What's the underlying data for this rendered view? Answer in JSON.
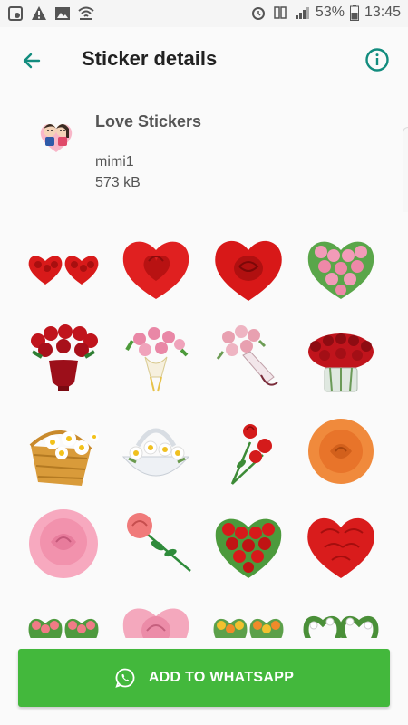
{
  "status_bar": {
    "battery_percent": "53%",
    "time": "13:45",
    "icons": [
      "gallery-icon",
      "alert-icon",
      "image-icon",
      "wifi-icon",
      "alarm-icon",
      "signal-icon",
      "battery-icon"
    ]
  },
  "app_bar": {
    "title": "Sticker details",
    "back_icon": "arrow-left-icon",
    "info_icon": "info-icon",
    "accent_color": "#128c7e"
  },
  "pack": {
    "name": "Love Stickers",
    "author": "mimi1",
    "size": "573 kB"
  },
  "stickers": [
    {
      "name": "double-heart-roses"
    },
    {
      "name": "red-rose-heart"
    },
    {
      "name": "red-rose-heart-2"
    },
    {
      "name": "pink-roses-heart"
    },
    {
      "name": "red-roses-vase"
    },
    {
      "name": "pink-roses-bouquet"
    },
    {
      "name": "pink-roses-bouquet-2"
    },
    {
      "name": "red-roses-glass-vase"
    },
    {
      "name": "daisy-basket"
    },
    {
      "name": "daisy-white-basket"
    },
    {
      "name": "red-rose-stems"
    },
    {
      "name": "orange-rose"
    },
    {
      "name": "pink-rose"
    },
    {
      "name": "single-pink-rose"
    },
    {
      "name": "red-rose-heart-3"
    },
    {
      "name": "red-petal-heart"
    },
    {
      "name": "pink-roses-double-heart"
    },
    {
      "name": "pink-rose-heart"
    },
    {
      "name": "yellow-roses-double-heart"
    },
    {
      "name": "white-flowers-double-heart"
    }
  ],
  "add_button": {
    "label": "ADD TO WHATSAPP",
    "color": "#43b83c"
  }
}
